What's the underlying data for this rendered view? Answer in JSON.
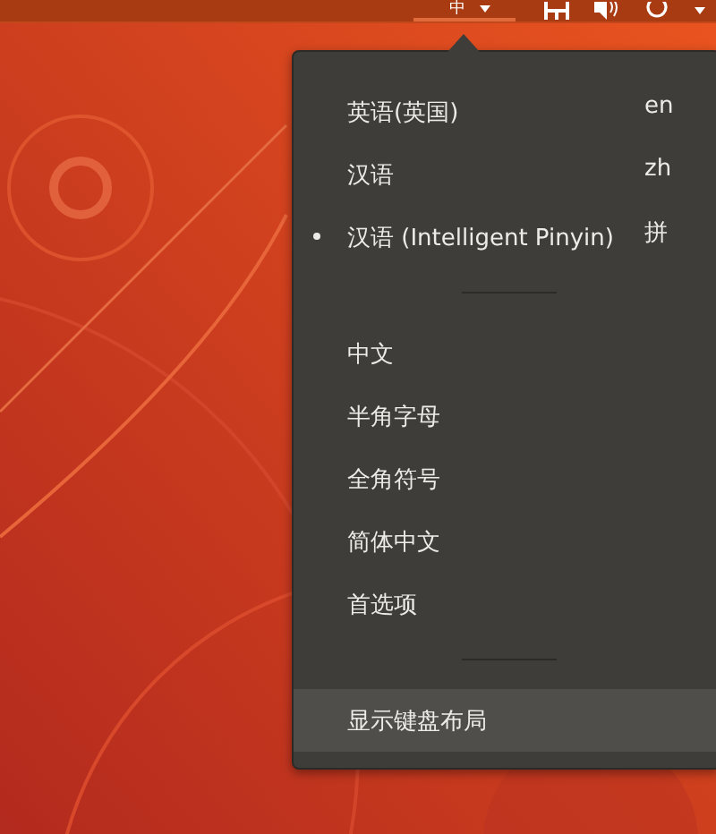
{
  "top_bar": {
    "input_indicator": "中"
  },
  "menu": {
    "sections": [
      [
        {
          "kind": "radio",
          "label": "英语(英国)",
          "shortcut": "en",
          "selected": false,
          "highlighted": false
        },
        {
          "kind": "radio",
          "label": "汉语",
          "shortcut": "zh",
          "selected": false,
          "highlighted": false
        },
        {
          "kind": "radio",
          "label": "汉语 (Intelligent Pinyin)",
          "shortcut": "拼",
          "selected": true,
          "highlighted": false
        }
      ],
      [
        {
          "kind": "action",
          "label": "中文",
          "highlighted": false
        },
        {
          "kind": "action",
          "label": "半角字母",
          "highlighted": false
        },
        {
          "kind": "action",
          "label": "全角符号",
          "highlighted": false
        },
        {
          "kind": "action",
          "label": "简体中文",
          "highlighted": false
        },
        {
          "kind": "action",
          "label": "首选项",
          "highlighted": false
        }
      ],
      [
        {
          "kind": "action",
          "label": "显示键盘布局",
          "highlighted": true
        }
      ]
    ]
  }
}
